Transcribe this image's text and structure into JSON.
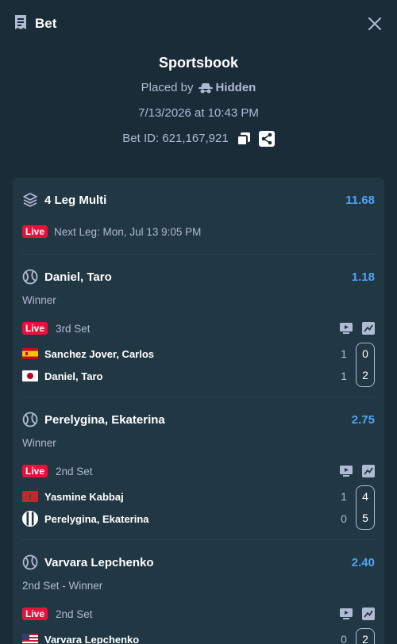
{
  "header": {
    "title": "Bet"
  },
  "summary": {
    "title": "Sportsbook",
    "placed_by_label": "Placed by",
    "placed_by_user": "Hidden",
    "datetime": "7/13/2026 at 10:43 PM",
    "bet_id": "Bet ID: 621,167,921"
  },
  "multi": {
    "title": "4 Leg Multi",
    "odds": "11.68",
    "live": "Live",
    "next_leg": "Next Leg: Mon, Jul 13 9:05 PM"
  },
  "legs": [
    {
      "title": "Daniel, Taro",
      "odds": "1.18",
      "market": "Winner",
      "live": "Live",
      "status": "3rd Set",
      "players": [
        {
          "name": "Sanchez Jover, Carlos",
          "flag": "spain",
          "set": "1",
          "game": "0"
        },
        {
          "name": "Daniel, Taro",
          "flag": "japan",
          "set": "1",
          "game": "2"
        }
      ]
    },
    {
      "title": "Perelygina, Ekaterina",
      "odds": "2.75",
      "market": "Winner",
      "live": "Live",
      "status": "2nd Set",
      "players": [
        {
          "name": "Yasmine Kabbaj",
          "flag": "morocco",
          "set": "1",
          "game": "4"
        },
        {
          "name": "Perelygina, Ekaterina",
          "flag": "neutral",
          "set": "0",
          "game": "5"
        }
      ]
    },
    {
      "title": "Varvara Lepchenko",
      "odds": "2.40",
      "market": "2nd Set - Winner",
      "live": "Live",
      "status": "2nd Set",
      "players": [
        {
          "name": "Varvara Lepchenko",
          "flag": "usa",
          "set": "0",
          "game": "2"
        },
        {
          "name": "",
          "flag": "",
          "set": "",
          "game": ""
        }
      ]
    }
  ],
  "colors": {
    "background": "#1a2c38",
    "card": "#213743",
    "odds": "#4fa3f7",
    "live": "#e9113c",
    "text_muted": "#b1bad3"
  }
}
